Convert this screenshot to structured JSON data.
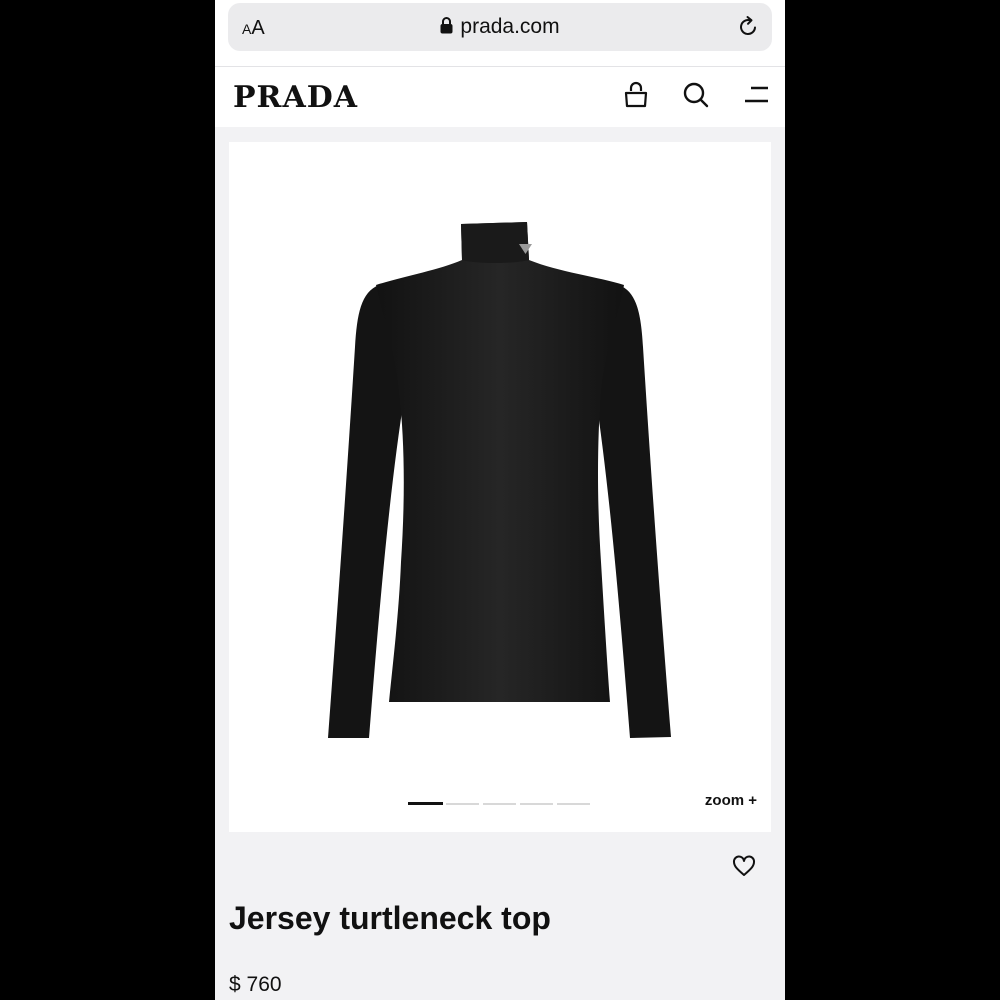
{
  "browser": {
    "text_size_button": {
      "small": "A",
      "large": "A"
    },
    "url": "prada.com",
    "lock_icon": "lock-icon",
    "reload_icon": "reload-icon"
  },
  "header": {
    "logo": "PRADA",
    "icons": [
      "shopping-bag-icon",
      "search-icon",
      "menu-icon"
    ]
  },
  "product": {
    "image_alt": "black jersey turtleneck top",
    "carousel": {
      "total": 5,
      "current": 1
    },
    "zoom_label": "zoom +",
    "favorite_icon": "heart-icon",
    "name": "Jersey turtleneck top",
    "price": "$ 760"
  }
}
